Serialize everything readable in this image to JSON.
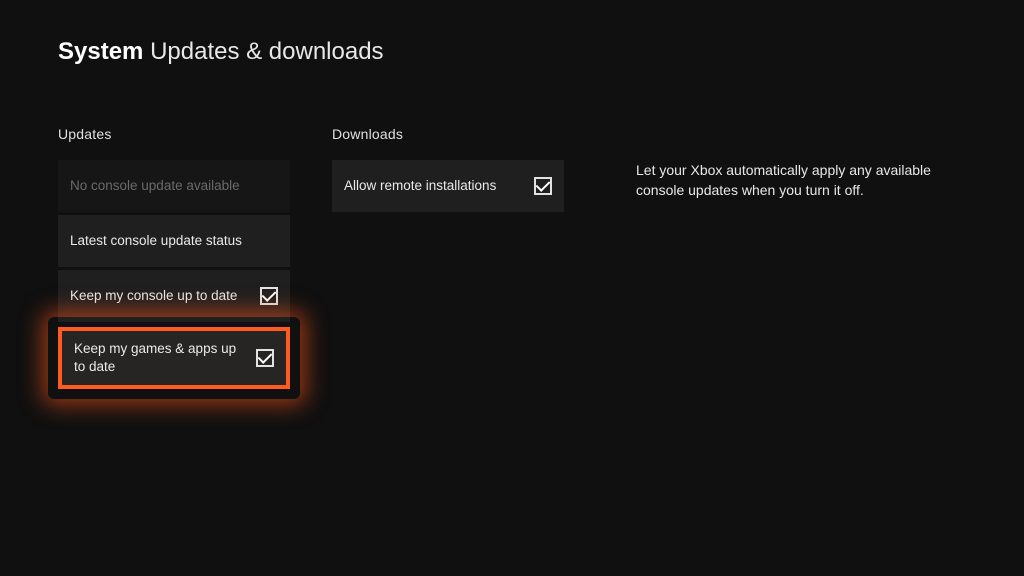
{
  "header": {
    "category": "System",
    "title": "Updates & downloads"
  },
  "updates": {
    "section_title": "Updates",
    "no_update_label": "No console update available",
    "status_label": "Latest console update status",
    "console_up_to_date_label": "Keep my console up to date",
    "games_apps_label": "Keep my games & apps up to date"
  },
  "downloads": {
    "section_title": "Downloads",
    "allow_remote_label": "Allow remote installations"
  },
  "description": {
    "text": "Let your Xbox automatically apply any available console updates when you turn it off."
  }
}
